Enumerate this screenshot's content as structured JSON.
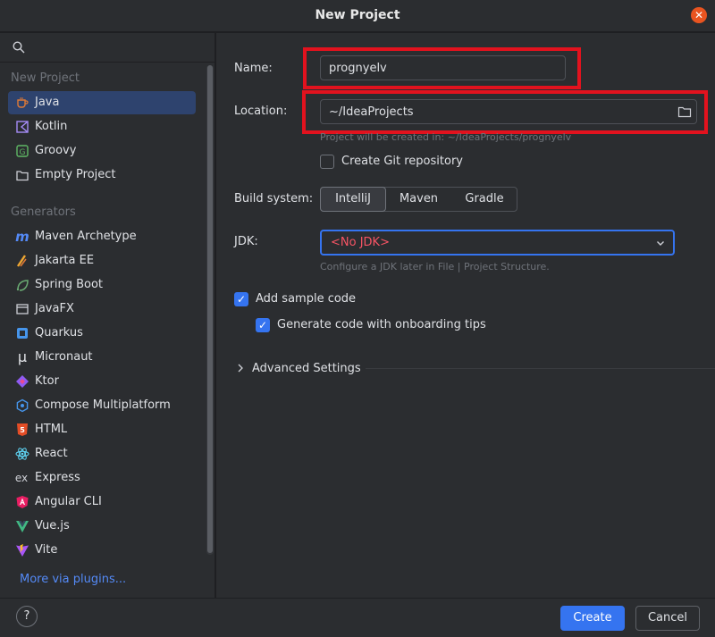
{
  "window": {
    "title": "New Project"
  },
  "sidebar": {
    "section_new_project": "New Project",
    "new_project_items": [
      {
        "label": "Java",
        "icon": "java-cup-icon",
        "selected": true
      },
      {
        "label": "Kotlin",
        "icon": "kotlin-icon"
      },
      {
        "label": "Groovy",
        "icon": "groovy-icon"
      },
      {
        "label": "Empty Project",
        "icon": "folder-icon"
      }
    ],
    "section_generators": "Generators",
    "generator_items": [
      {
        "label": "Maven Archetype",
        "icon": "maven-icon"
      },
      {
        "label": "Jakarta EE",
        "icon": "jakarta-icon"
      },
      {
        "label": "Spring Boot",
        "icon": "spring-boot-icon"
      },
      {
        "label": "JavaFX",
        "icon": "javafx-icon"
      },
      {
        "label": "Quarkus",
        "icon": "quarkus-icon"
      },
      {
        "label": "Micronaut",
        "icon": "micronaut-icon"
      },
      {
        "label": "Ktor",
        "icon": "ktor-icon"
      },
      {
        "label": "Compose Multiplatform",
        "icon": "compose-icon"
      },
      {
        "label": "HTML",
        "icon": "html5-icon"
      },
      {
        "label": "React",
        "icon": "react-icon"
      },
      {
        "label": "Express",
        "icon": "express-icon"
      },
      {
        "label": "Angular CLI",
        "icon": "angular-icon"
      },
      {
        "label": "Vue.js",
        "icon": "vue-icon"
      },
      {
        "label": "Vite",
        "icon": "vite-icon"
      }
    ],
    "more_link": "More via plugins..."
  },
  "form": {
    "name_label": "Name:",
    "name_value": "prognyelv",
    "location_label": "Location:",
    "location_value": "~/IdeaProjects",
    "location_hint": "Project will be created in: ~/IdeaProjects/prognyelv",
    "git_label": "Create Git repository",
    "git_checked": false,
    "build_system_label": "Build system:",
    "build_systems": [
      "IntelliJ",
      "Maven",
      "Gradle"
    ],
    "build_system_selected": "IntelliJ",
    "jdk_label": "JDK:",
    "jdk_value": "<No JDK>",
    "jdk_hint": "Configure a JDK later in File | Project Structure.",
    "sample_code_label": "Add sample code",
    "sample_code_checked": true,
    "onboarding_label": "Generate code with onboarding tips",
    "onboarding_checked": true,
    "advanced_label": "Advanced Settings"
  },
  "footer": {
    "help_label": "?",
    "create_label": "Create",
    "cancel_label": "Cancel"
  },
  "colors": {
    "accent": "#3574f0",
    "highlight_box": "#e2121e",
    "error_text": "#f75464",
    "close_button": "#e95420"
  }
}
